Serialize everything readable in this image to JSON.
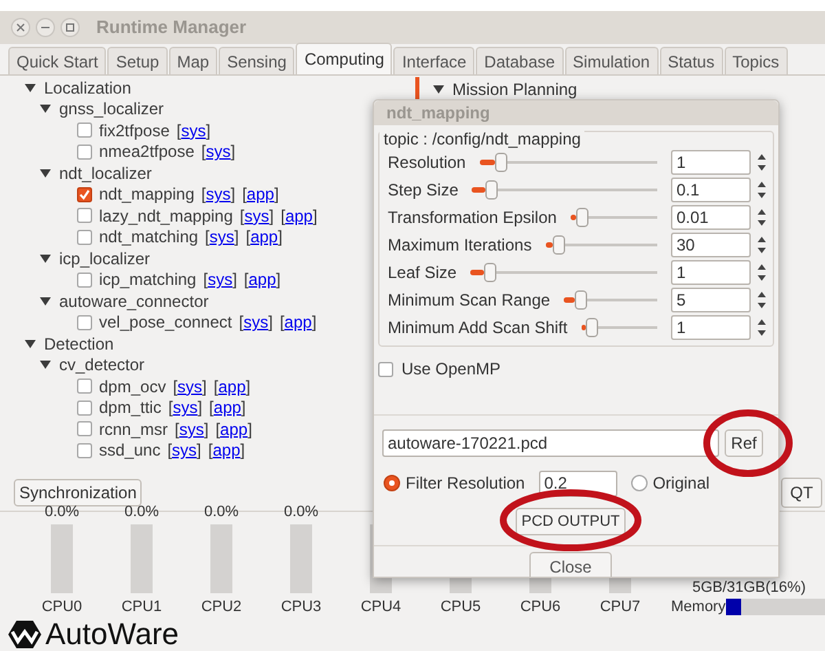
{
  "window": {
    "title": "Runtime Manager"
  },
  "tabs": [
    {
      "label": "Quick Start",
      "selected": false
    },
    {
      "label": "Setup",
      "selected": false
    },
    {
      "label": "Map",
      "selected": false
    },
    {
      "label": "Sensing",
      "selected": false
    },
    {
      "label": "Computing",
      "selected": true
    },
    {
      "label": "Interface",
      "selected": false
    },
    {
      "label": "Database",
      "selected": false
    },
    {
      "label": "Simulation",
      "selected": false
    },
    {
      "label": "Status",
      "selected": false
    },
    {
      "label": "Topics",
      "selected": false
    }
  ],
  "tree": [
    {
      "label": "Localization",
      "expanded": true,
      "children": [
        {
          "label": "gnss_localizer",
          "expanded": true,
          "children": [
            {
              "label": "fix2tfpose",
              "checked": false,
              "links": [
                "[sys]"
              ]
            },
            {
              "label": "nmea2tfpose",
              "checked": false,
              "links": [
                "[sys]"
              ]
            }
          ]
        },
        {
          "label": "ndt_localizer",
          "expanded": true,
          "children": [
            {
              "label": "ndt_mapping",
              "checked": true,
              "links": [
                "[sys]",
                "[app]"
              ]
            },
            {
              "label": "lazy_ndt_mapping",
              "checked": false,
              "links": [
                "[sys]",
                "[app]"
              ]
            },
            {
              "label": "ndt_matching",
              "checked": false,
              "links": [
                "[sys]",
                "[app]"
              ]
            }
          ]
        },
        {
          "label": "icp_localizer",
          "expanded": true,
          "children": [
            {
              "label": "icp_matching",
              "checked": false,
              "links": [
                "[sys]",
                "[app]"
              ]
            }
          ]
        },
        {
          "label": "autoware_connector",
          "expanded": true,
          "children": [
            {
              "label": "vel_pose_connect",
              "checked": false,
              "links": [
                "[sys]",
                "[app]"
              ]
            }
          ]
        }
      ]
    },
    {
      "label": "Detection",
      "expanded": true,
      "children": [
        {
          "label": "cv_detector",
          "expanded": true,
          "children": [
            {
              "label": "dpm_ocv",
              "checked": false,
              "links": [
                "[sys]",
                "[app]"
              ]
            },
            {
              "label": "dpm_ttic",
              "checked": false,
              "links": [
                "[sys]",
                "[app]"
              ]
            },
            {
              "label": "rcnn_msr",
              "checked": false,
              "links": [
                "[sys]",
                "[app]"
              ]
            },
            {
              "label": "ssd_unc",
              "checked": false,
              "links": [
                "[sys]",
                "[app]"
              ]
            }
          ]
        }
      ]
    }
  ],
  "sync_button": "Synchronization",
  "right_tree": {
    "label": "Mission Planning",
    "expanded": true
  },
  "right_button": "QT",
  "cpus": [
    {
      "label": "CPU0",
      "percent": "0.0%",
      "level": 0
    },
    {
      "label": "CPU1",
      "percent": "0.0%",
      "level": 0
    },
    {
      "label": "CPU2",
      "percent": "0.0%",
      "level": 0
    },
    {
      "label": "CPU3",
      "percent": "0.0%",
      "level": 0
    },
    {
      "label": "CPU4",
      "level": 0
    },
    {
      "label": "CPU5",
      "level": 0
    },
    {
      "label": "CPU6",
      "level": 0
    },
    {
      "label": "CPU7",
      "level": 0
    }
  ],
  "memory": {
    "label": "Memory",
    "reading": "5GB/31GB(16%)",
    "level": 0.16
  },
  "logo": {
    "text": "AutoWare"
  },
  "dialog": {
    "title": "ndt_mapping",
    "group_title": "topic : /config/ndt_mapping",
    "params": [
      {
        "label": "Resolution",
        "level": 0.12,
        "value": "1"
      },
      {
        "label": "Step Size",
        "level": 0.1,
        "value": "0.1"
      },
      {
        "label": "Transformation Epsilon",
        "level": 0.12,
        "value": "0.01"
      },
      {
        "label": "Maximum Iterations",
        "level": 0.12,
        "value": "30"
      },
      {
        "label": "Leaf Size",
        "level": 0.1,
        "value": "1"
      },
      {
        "label": "Minimum Scan Range",
        "level": 0.18,
        "value": "5"
      },
      {
        "label": "Minimum Add Scan Shift",
        "level": 0.13,
        "value": "1"
      }
    ],
    "openmp": {
      "label": "Use OpenMP",
      "checked": false
    },
    "file": {
      "value": "autoware-170221.pcd"
    },
    "ref_button": {
      "label": "Ref",
      "circled": true
    },
    "options": [
      {
        "label": "Filter Resolution",
        "selected": true,
        "value": "0.2"
      },
      {
        "label": "Original",
        "selected": false
      }
    ],
    "output_button": {
      "label": "PCD OUTPUT",
      "circled": true
    },
    "close_button": {
      "label": "Close"
    }
  }
}
